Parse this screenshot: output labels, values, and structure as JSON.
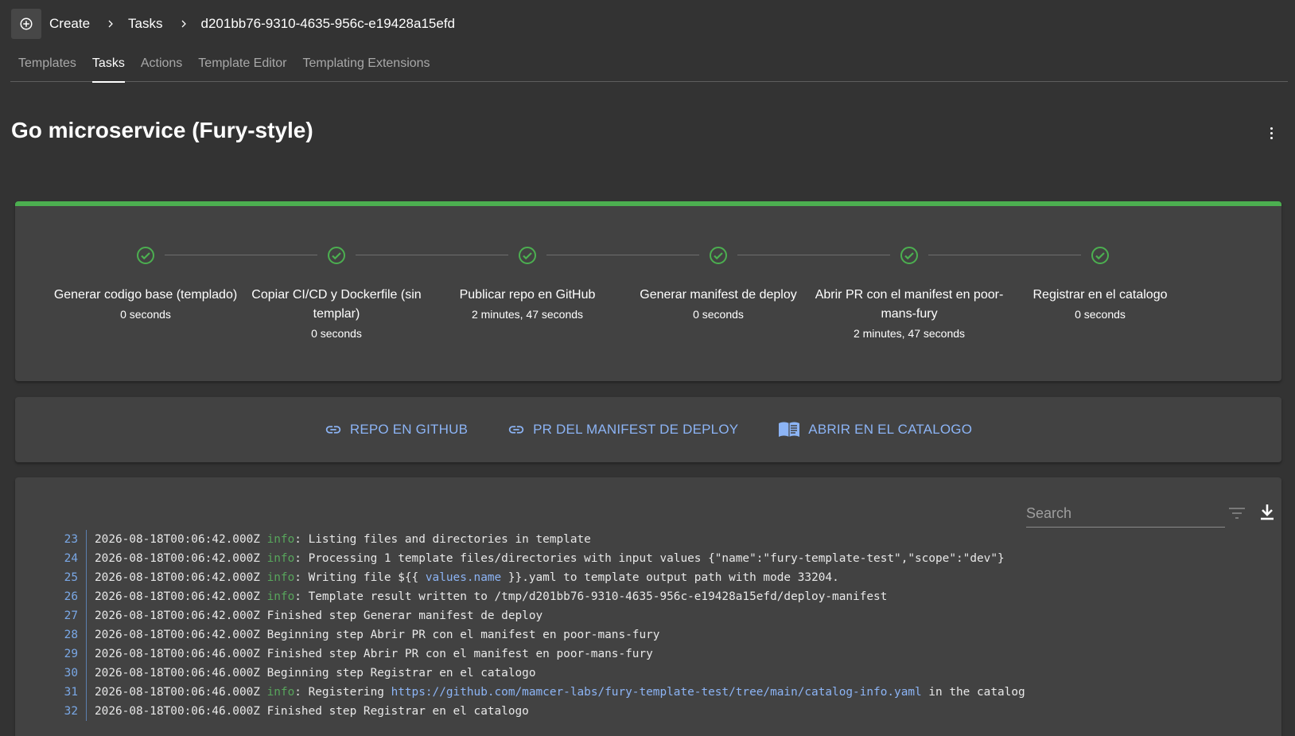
{
  "breadcrumb": {
    "create": "Create",
    "tasks": "Tasks",
    "task_id": "d201bb76-9310-4635-956c-e19428a15efd"
  },
  "tabs": [
    {
      "label": "Templates",
      "active": false
    },
    {
      "label": "Tasks",
      "active": true
    },
    {
      "label": "Actions",
      "active": false
    },
    {
      "label": "Template Editor",
      "active": false
    },
    {
      "label": "Templating Extensions",
      "active": false
    }
  ],
  "page_title": "Go microservice (Fury-style)",
  "progress": {
    "percent": 100,
    "color": "#4caf50"
  },
  "steps": [
    {
      "label": "Generar codigo base (templado)",
      "duration": "0 seconds",
      "status": "completed"
    },
    {
      "label": "Copiar CI/CD y Dockerfile (sin templar)",
      "duration": "0 seconds",
      "status": "completed"
    },
    {
      "label": "Publicar repo en GitHub",
      "duration": "2 minutes, 47 seconds",
      "status": "completed"
    },
    {
      "label": "Generar manifest de deploy",
      "duration": "0 seconds",
      "status": "completed"
    },
    {
      "label": "Abrir PR con el manifest en poor-mans-fury",
      "duration": "2 minutes, 47 seconds",
      "status": "completed"
    },
    {
      "label": "Registrar en el catalogo",
      "duration": "0 seconds",
      "status": "completed"
    }
  ],
  "links": [
    {
      "label": "REPO EN GITHUB",
      "icon": "link-icon"
    },
    {
      "label": "PR DEL MANIFEST DE DEPLOY",
      "icon": "link-icon"
    },
    {
      "label": "ABRIR EN EL CATALOGO",
      "icon": "catalog-book-icon"
    }
  ],
  "log": {
    "search_placeholder": "Search",
    "lines": [
      {
        "n": "23",
        "ts": "2026-08-18T00:06:42.000Z",
        "level": "info",
        "text": ": Listing files and directories in template"
      },
      {
        "n": "24",
        "ts": "2026-08-18T00:06:42.000Z",
        "level": "info",
        "text": ": Processing 1 template files/directories with input values {\"name\":\"fury-template-test\",\"scope\":\"dev\"}"
      },
      {
        "n": "25",
        "ts": "2026-08-18T00:06:42.000Z",
        "level": "info",
        "text": ": Writing file ${{ ",
        "highlight": "values.name",
        "after": " }}.yaml to template output path with mode 33204."
      },
      {
        "n": "26",
        "ts": "2026-08-18T00:06:42.000Z",
        "level": "info",
        "text": ": Template result written to /tmp/d201bb76-9310-4635-956c-e19428a15efd/deploy-manifest"
      },
      {
        "n": "27",
        "ts": "2026-08-18T00:06:42.000Z",
        "level": "",
        "text": "Finished step Generar manifest de deploy"
      },
      {
        "n": "28",
        "ts": "2026-08-18T00:06:42.000Z",
        "level": "",
        "text": "Beginning step Abrir PR con el manifest en poor-mans-fury"
      },
      {
        "n": "29",
        "ts": "2026-08-18T00:06:46.000Z",
        "level": "",
        "text": "Finished step Abrir PR con el manifest en poor-mans-fury"
      },
      {
        "n": "30",
        "ts": "2026-08-18T00:06:46.000Z",
        "level": "",
        "text": "Beginning step Registrar en el catalogo"
      },
      {
        "n": "31",
        "ts": "2026-08-18T00:06:46.000Z",
        "level": "info",
        "text": ": Registering ",
        "highlight": "https://github.com/mamcer-labs/fury-template-test/tree/main/catalog-info.yaml",
        "after": " in the catalog"
      },
      {
        "n": "32",
        "ts": "2026-08-18T00:06:46.000Z",
        "level": "",
        "text": "Finished step Registrar en el catalogo"
      }
    ]
  },
  "colors": {
    "background": "#333333",
    "card": "#424242",
    "success": "#4caf50",
    "link": "#8cb4f5",
    "log_level": "#58a65c"
  }
}
